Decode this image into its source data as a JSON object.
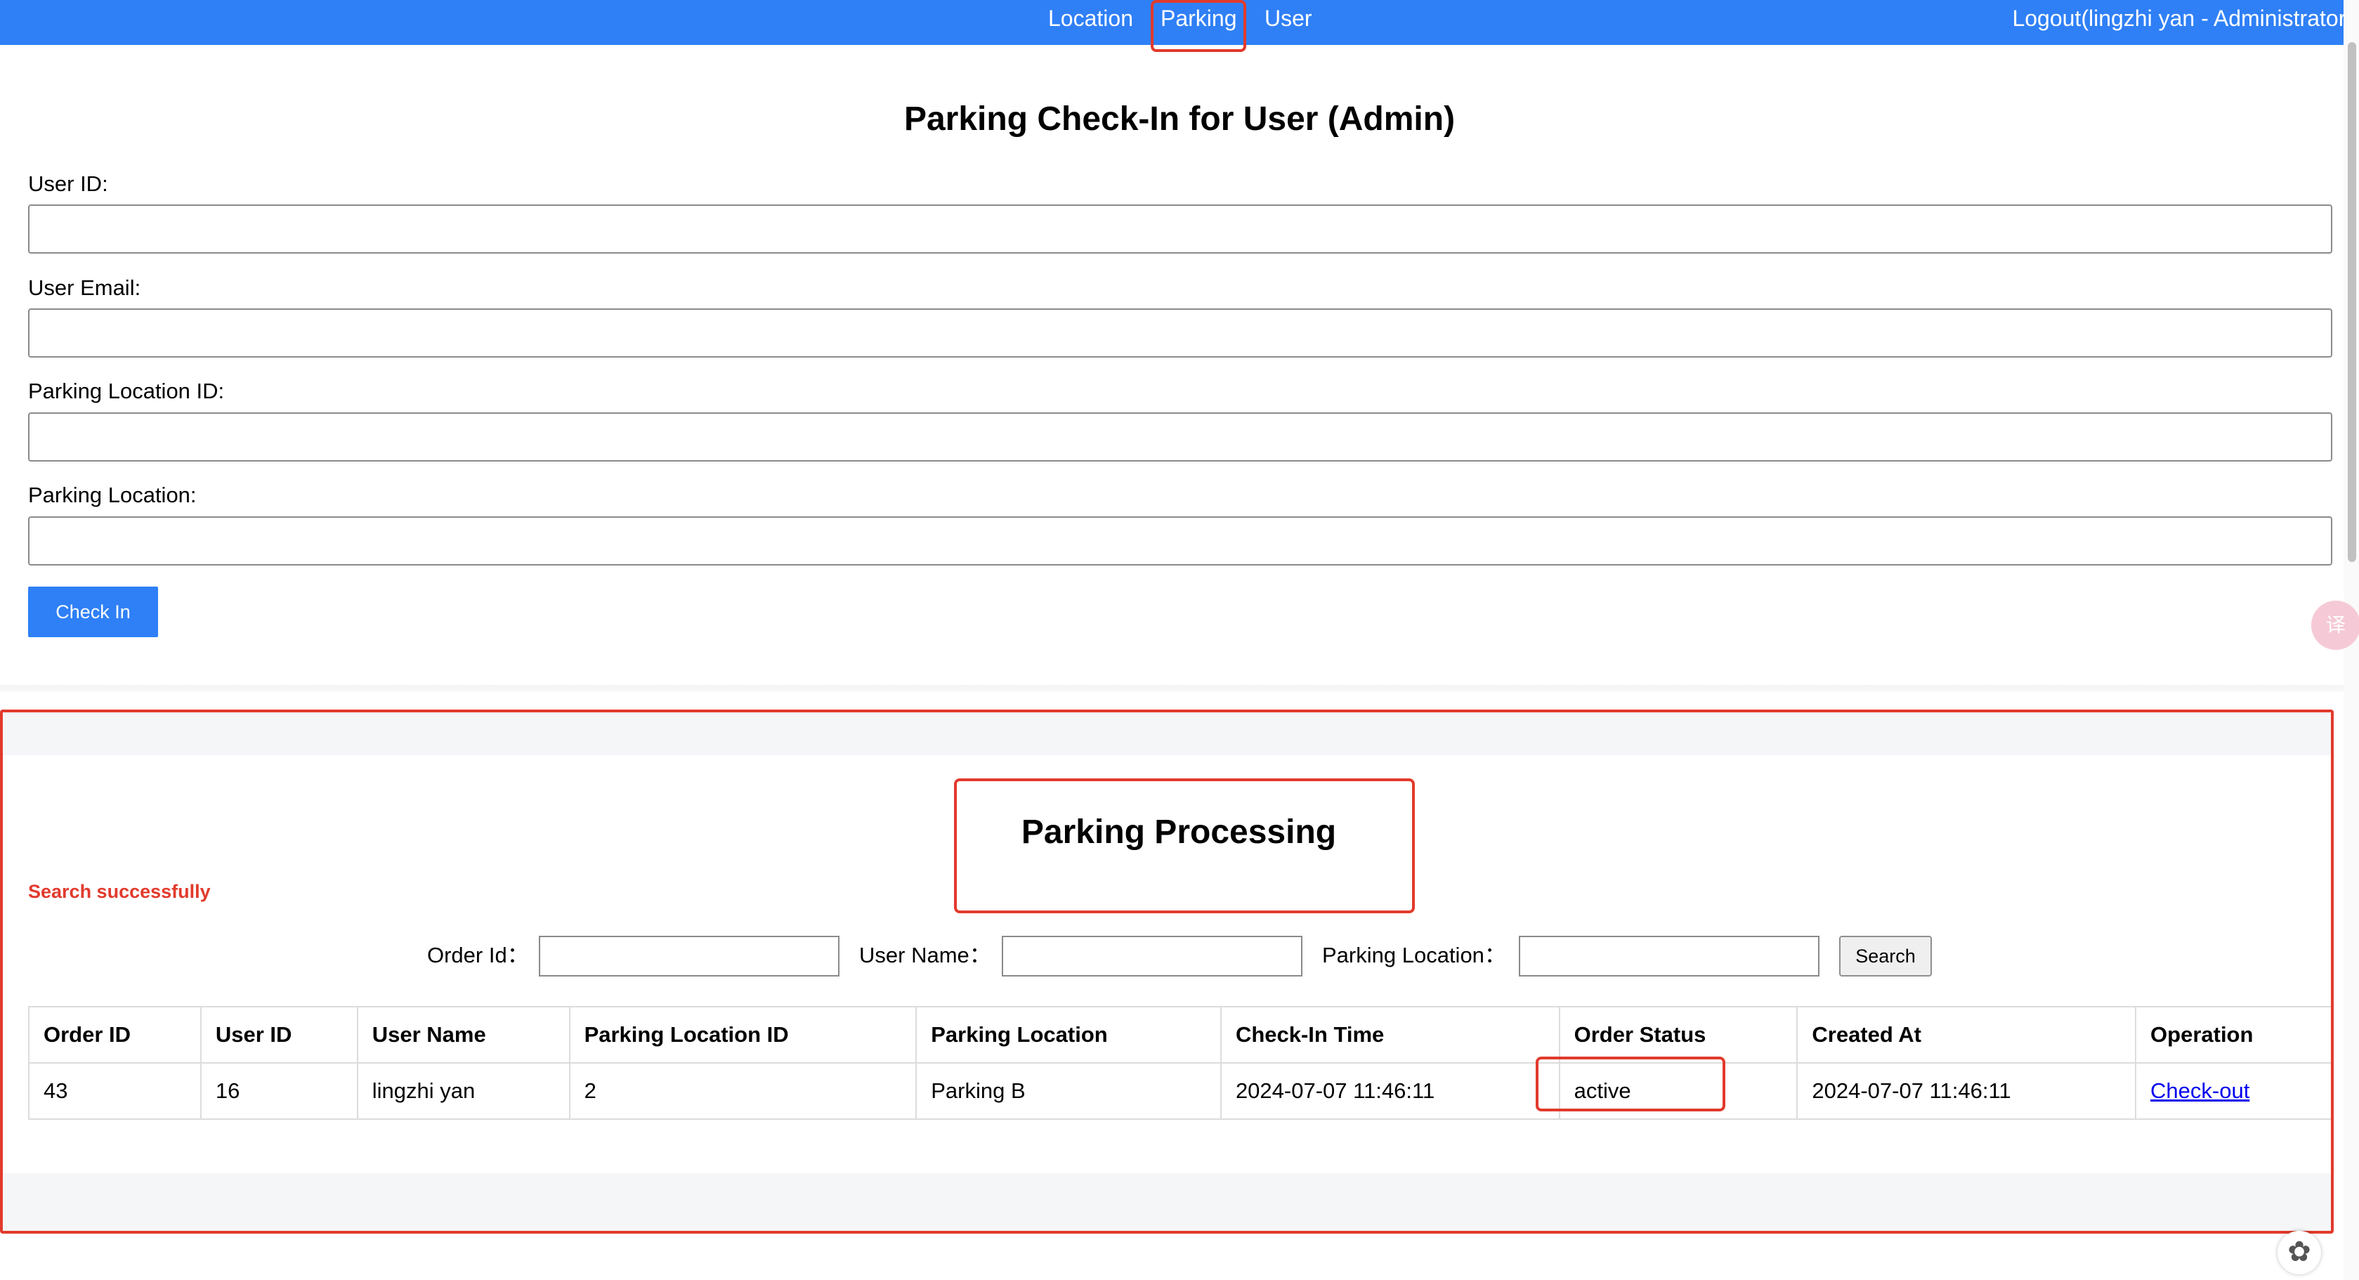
{
  "nav": {
    "items": [
      "Location",
      "Parking",
      "User"
    ],
    "active": "Parking",
    "logout_label": "Logout(lingzhi yan - Administrator)"
  },
  "checkin_form": {
    "title": "Parking Check-In for User (Admin)",
    "fields": [
      {
        "label": "User ID:",
        "value": ""
      },
      {
        "label": "User Email:",
        "value": ""
      },
      {
        "label": "Parking Location ID:",
        "value": ""
      },
      {
        "label": "Parking Location:",
        "value": ""
      }
    ],
    "submit_label": "Check In"
  },
  "processing": {
    "title": "Parking Processing",
    "message": "Search successfully",
    "search": {
      "order_id_label": "Order Id：",
      "order_id_value": "",
      "user_name_label": "User Name：",
      "user_name_value": "",
      "parking_location_label": "Parking Location：",
      "parking_location_value": "",
      "button_label": "Search"
    },
    "table": {
      "headers": [
        "Order ID",
        "User ID",
        "User Name",
        "Parking Location ID",
        "Parking Location",
        "Check-In Time",
        "Order Status",
        "Created At",
        "Operation"
      ],
      "rows": [
        [
          "43",
          "16",
          "lingzhi yan",
          "2",
          "Parking B",
          "2024-07-07 11:46:11",
          "active",
          "2024-07-07 11:46:11",
          "Check-out"
        ]
      ]
    }
  },
  "colors": {
    "nav_bg": "#2f80f6",
    "primary_button": "#2f80f6",
    "highlight": "#e23a2c",
    "success_message": "#e23a2c",
    "link": "#0000ee"
  },
  "icons": {
    "translate": "translate-icon",
    "assistant": "assistant-icon"
  }
}
